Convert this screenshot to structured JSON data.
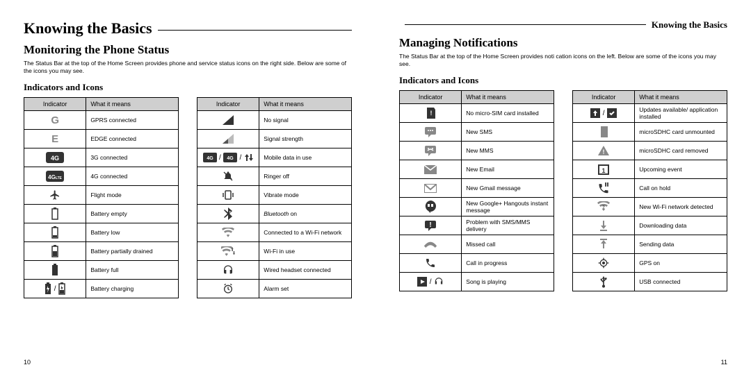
{
  "leftPage": {
    "header": "Knowing the Basics",
    "sectionTitle": "Monitoring the Phone Status",
    "intro": "The Status Bar at the top of the Home Screen provides phone and service status icons on the right side. Below are some of the icons you may see.",
    "subTitle": "Indicators and Icons",
    "col1": "Indicator",
    "col2": "What it means",
    "tableA": [
      {
        "icon": "gprs",
        "text": "GPRS connected"
      },
      {
        "icon": "edge",
        "text": "EDGE connected"
      },
      {
        "icon": "3g",
        "text": "3G connected"
      },
      {
        "icon": "4g",
        "text": "4G connected"
      },
      {
        "icon": "airplane",
        "text": "Flight mode"
      },
      {
        "icon": "batt-empty",
        "text": "Battery empty"
      },
      {
        "icon": "batt-low",
        "text": "Battery low"
      },
      {
        "icon": "batt-partial",
        "text": "Battery partially drained"
      },
      {
        "icon": "batt-full",
        "text": "Battery full"
      },
      {
        "icon": "batt-charging",
        "text": "Battery charging"
      }
    ],
    "tableB": [
      {
        "icon": "no-signal",
        "text": "No signal"
      },
      {
        "icon": "signal",
        "text": "Signal strength"
      },
      {
        "icon": "mobile-data",
        "text": "Mobile data in use"
      },
      {
        "icon": "ringer-off",
        "text": "Ringer off"
      },
      {
        "icon": "vibrate",
        "text": "Vibrate mode"
      },
      {
        "icon": "bluetooth",
        "text": "Bluetooth on",
        "italicPrefix": "Bluetooth",
        "suffix": " on"
      },
      {
        "icon": "wifi-connected",
        "text": "Connected to a Wi-Fi network"
      },
      {
        "icon": "wifi-inuse",
        "text": "Wi-Fi in use"
      },
      {
        "icon": "headset",
        "text": "Wired headset connected"
      },
      {
        "icon": "alarm",
        "text": "Alarm set"
      }
    ],
    "pageNum": "10"
  },
  "rightPage": {
    "header": "Knowing the Basics",
    "sectionTitle": "Managing Notifications",
    "intro": "The Status Bar at the top of the Home Screen provides noti cation icons on the left. Below are some of the icons you may see.",
    "subTitle": "Indicators and Icons",
    "col1": "Indicator",
    "col2": "What it means",
    "tableA": [
      {
        "icon": "no-sim",
        "text": "No micro-SIM card installed"
      },
      {
        "icon": "sms",
        "text": "New SMS"
      },
      {
        "icon": "mms",
        "text": "New MMS"
      },
      {
        "icon": "email",
        "text": "New Email"
      },
      {
        "icon": "gmail",
        "text": "New Gmail message"
      },
      {
        "icon": "hangouts",
        "text": "New Google+ Hangouts instant message"
      },
      {
        "icon": "sms-problem",
        "text": "Problem with SMS/MMS delivery"
      },
      {
        "icon": "missed-call",
        "text": "Missed call"
      },
      {
        "icon": "call",
        "text": "Call in progress"
      },
      {
        "icon": "music",
        "text": "Song is playing"
      }
    ],
    "tableB": [
      {
        "icon": "updates",
        "text": "Updates available/ application installed"
      },
      {
        "icon": "sd-unmount",
        "text": "microSDHC card unmounted"
      },
      {
        "icon": "sd-removed",
        "text": "microSDHC card removed"
      },
      {
        "icon": "calendar",
        "text": "Upcoming event"
      },
      {
        "icon": "call-hold",
        "text": "Call on hold"
      },
      {
        "icon": "wifi-new",
        "text": "New Wi-Fi network detected"
      },
      {
        "icon": "download",
        "text": "Downloading data"
      },
      {
        "icon": "upload",
        "text": "Sending data"
      },
      {
        "icon": "gps",
        "text": "GPS on"
      },
      {
        "icon": "usb",
        "text": "USB connected"
      }
    ],
    "pageNum": "11"
  }
}
